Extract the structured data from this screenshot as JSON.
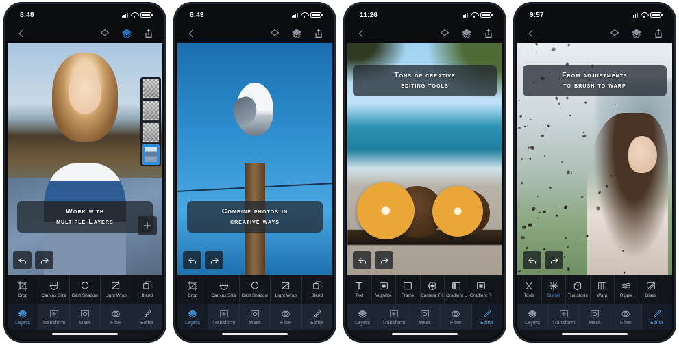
{
  "app": {
    "name": "photo-editor-app-store-gallery"
  },
  "screens": [
    {
      "id": "screen-1",
      "status": {
        "time": "8:48",
        "signal": "signal-icon",
        "wifi": "wifi-icon",
        "battery": "battery-icon"
      },
      "nav": {
        "back": "back-chevron-icon",
        "layers_flat": "layers-flat-icon",
        "layers_stack": "layers-stack-icon",
        "share": "share-icon",
        "stack_active": true
      },
      "caption": {
        "line1": "Work with",
        "line2": "multiple Layers",
        "position": "bottom"
      },
      "canvas": {
        "undo": "undo-icon",
        "redo": "redo-icon",
        "add": "plus-icon",
        "scene": "woman-portrait-landscape-composite"
      },
      "layers_panel": {
        "visible": true,
        "count": 4,
        "selected_index": 3
      },
      "toolstrip": [
        {
          "label": "Crop",
          "icon": "crop-icon",
          "active": false
        },
        {
          "label": "Canvas Size",
          "icon": "canvas-size-icon",
          "active": false
        },
        {
          "label": "Cast Shadow",
          "icon": "cast-shadow-icon",
          "active": false
        },
        {
          "label": "Light Wrap",
          "icon": "light-wrap-icon",
          "active": false
        },
        {
          "label": "Blend",
          "icon": "blend-icon",
          "active": false
        }
      ],
      "tabs": [
        {
          "label": "Layers",
          "icon": "layers-diamond-icon",
          "active": true
        },
        {
          "label": "Transform",
          "icon": "transform-icon",
          "active": false
        },
        {
          "label": "Mask",
          "icon": "mask-icon",
          "active": false
        },
        {
          "label": "Filter",
          "icon": "filter-icon",
          "active": false
        },
        {
          "label": "Editor",
          "icon": "pencil-icon",
          "active": false
        }
      ]
    },
    {
      "id": "screen-2",
      "status": {
        "time": "8:49",
        "signal": "signal-icon",
        "wifi": "wifi-icon",
        "battery": "battery-icon"
      },
      "nav": {
        "back": "back-chevron-icon",
        "layers_flat": "layers-flat-icon",
        "layers_stack": "layers-stack-icon",
        "share": "share-icon",
        "stack_active": false
      },
      "caption": {
        "line1": "Combine photos in",
        "line2": "creative ways",
        "position": "bottom"
      },
      "canvas": {
        "undo": "undo-icon",
        "redo": "redo-icon",
        "add": null,
        "scene": "seagull-on-post-blue-sky"
      },
      "layers_panel": {
        "visible": false,
        "count": 0,
        "selected_index": -1
      },
      "toolstrip": [
        {
          "label": "Crop",
          "icon": "crop-icon",
          "active": false
        },
        {
          "label": "Canvas Size",
          "icon": "canvas-size-icon",
          "active": false
        },
        {
          "label": "Cast Shadow",
          "icon": "cast-shadow-icon",
          "active": false
        },
        {
          "label": "Light Wrap",
          "icon": "light-wrap-icon",
          "active": false
        },
        {
          "label": "Blend",
          "icon": "blend-icon",
          "active": false
        }
      ],
      "tabs": [
        {
          "label": "Layers",
          "icon": "layers-diamond-icon",
          "active": true
        },
        {
          "label": "Transform",
          "icon": "transform-icon",
          "active": false
        },
        {
          "label": "Mask",
          "icon": "mask-icon",
          "active": false
        },
        {
          "label": "Filter",
          "icon": "filter-icon",
          "active": false
        },
        {
          "label": "Editor",
          "icon": "pencil-icon",
          "active": false
        }
      ]
    },
    {
      "id": "screen-3",
      "status": {
        "time": "11:26",
        "signal": "signal-icon",
        "wifi": "wifi-icon",
        "battery": "battery-icon"
      },
      "nav": {
        "back": "back-chevron-icon",
        "layers_flat": "layers-flat-icon",
        "layers_stack": "layers-stack-icon",
        "share": "share-icon",
        "stack_active": false
      },
      "caption": {
        "line1": "Tons of creative",
        "line2": "editing tools",
        "position": "top"
      },
      "canvas": {
        "undo": "undo-icon",
        "redo": "redo-icon",
        "add": null,
        "scene": "beach-orange-coconut-palms"
      },
      "layers_panel": {
        "visible": false,
        "count": 0,
        "selected_index": -1
      },
      "toolstrip": [
        {
          "label": "Text",
          "icon": "text-icon",
          "active": false
        },
        {
          "label": "Vignette",
          "icon": "vignette-icon",
          "active": false
        },
        {
          "label": "Frame",
          "icon": "frame-icon",
          "active": false
        },
        {
          "label": "Camera Fill",
          "icon": "camera-fill-icon",
          "active": false
        },
        {
          "label": "Gradient L",
          "icon": "gradient-linear-icon",
          "active": false
        },
        {
          "label": "Gradient R",
          "icon": "gradient-radial-icon",
          "active": false
        }
      ],
      "tabs": [
        {
          "label": "Layers",
          "icon": "layers-diamond-icon",
          "active": false
        },
        {
          "label": "Transform",
          "icon": "transform-icon",
          "active": false
        },
        {
          "label": "Mask",
          "icon": "mask-icon",
          "active": false
        },
        {
          "label": "Filter",
          "icon": "filter-icon",
          "active": false
        },
        {
          "label": "Editor",
          "icon": "pencil-icon",
          "active": true
        }
      ]
    },
    {
      "id": "screen-4",
      "status": {
        "time": "9:57",
        "signal": "signal-icon",
        "wifi": "wifi-icon",
        "battery": "battery-icon"
      },
      "nav": {
        "back": "back-chevron-icon",
        "layers_flat": "layers-flat-icon",
        "layers_stack": "layers-stack-icon",
        "share": "share-icon",
        "stack_active": false
      },
      "caption": {
        "line1": "From adjustments",
        "line2": "to brush to warp",
        "position": "top"
      },
      "canvas": {
        "undo": "undo-icon",
        "redo": "redo-icon",
        "add": null,
        "scene": "woman-tiara-dispersion-effect"
      },
      "layers_panel": {
        "visible": false,
        "count": 0,
        "selected_index": -1
      },
      "toolstrip": [
        {
          "label": "Tools",
          "icon": "tools-icon",
          "active": false
        },
        {
          "label": "Distort",
          "icon": "distort-icon",
          "active": true
        },
        {
          "label": "Transform",
          "icon": "transform-box-icon",
          "active": false
        },
        {
          "label": "Warp",
          "icon": "warp-grid-icon",
          "active": false
        },
        {
          "label": "Ripple",
          "icon": "ripple-icon",
          "active": false
        },
        {
          "label": "Glass",
          "icon": "glass-icon",
          "active": false
        }
      ],
      "tabs": [
        {
          "label": "Layers",
          "icon": "layers-diamond-icon",
          "active": false
        },
        {
          "label": "Transform",
          "icon": "transform-icon",
          "active": false
        },
        {
          "label": "Mask",
          "icon": "mask-icon",
          "active": false
        },
        {
          "label": "Filter",
          "icon": "filter-icon",
          "active": false
        },
        {
          "label": "Editor",
          "icon": "pencil-icon",
          "active": true
        }
      ]
    }
  ],
  "colors": {
    "accent_blue": "#2f8ce0",
    "tab_active_text": "#6fa8dd",
    "tabbar_bg": "#1e2633",
    "toolstrip_bg": "#12151a",
    "statusbar_bg": "#0a0c0f",
    "caption_bg": "rgba(36,42,50,0.76)"
  }
}
